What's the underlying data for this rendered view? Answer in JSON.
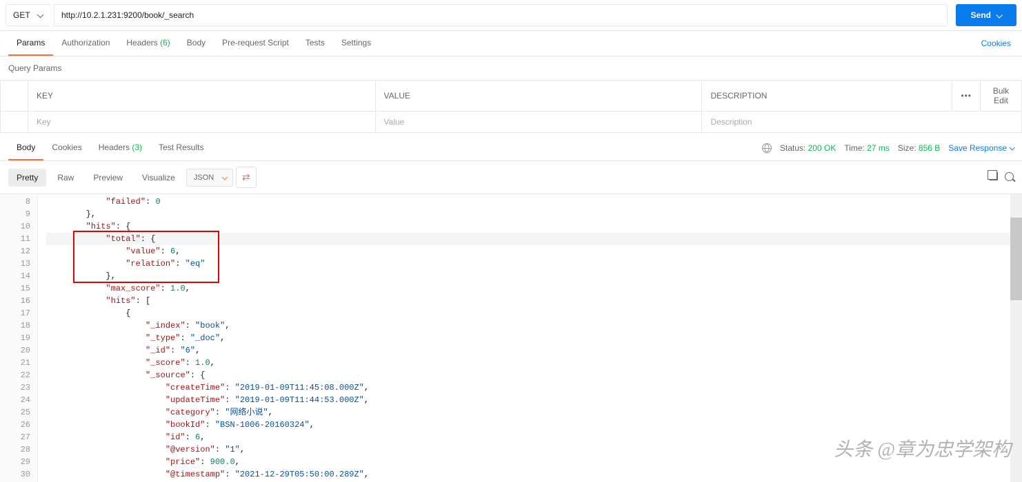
{
  "request": {
    "method": "GET",
    "url": "http://10.2.1.231:9200/book/_search"
  },
  "actions": {
    "send": "Send",
    "cookies": "Cookies"
  },
  "reqTabs": {
    "params": "Params",
    "auth": "Authorization",
    "headers": "Headers",
    "headers_count": "(6)",
    "body": "Body",
    "prereq": "Pre-request Script",
    "tests": "Tests",
    "settings": "Settings"
  },
  "paramsSection": {
    "title": "Query Params",
    "cols": {
      "key": "KEY",
      "value": "VALUE",
      "desc": "DESCRIPTION",
      "bulk": "Bulk Edit"
    },
    "placeholders": {
      "key": "Key",
      "value": "Value",
      "desc": "Description"
    }
  },
  "respTabs": {
    "body": "Body",
    "cookies": "Cookies",
    "headers": "Headers",
    "headers_count": "(3)",
    "tests": "Test Results"
  },
  "respMeta": {
    "status_label": "Status:",
    "status_value": "200 OK",
    "time_label": "Time:",
    "time_value": "27 ms",
    "size_label": "Size:",
    "size_value": "856 B",
    "save": "Save Response"
  },
  "viewBar": {
    "pretty": "Pretty",
    "raw": "Raw",
    "preview": "Preview",
    "visualize": "Visualize",
    "format": "JSON"
  },
  "codeLines": [
    {
      "n": 8,
      "indent": 3,
      "tokens": [
        [
          "key",
          "\"failed\""
        ],
        [
          "punc",
          ": "
        ],
        [
          "num",
          "0"
        ]
      ]
    },
    {
      "n": 9,
      "indent": 2,
      "tokens": [
        [
          "punc",
          "},"
        ]
      ]
    },
    {
      "n": 10,
      "indent": 2,
      "tokens": [
        [
          "key",
          "\"hits\""
        ],
        [
          "punc",
          ": {"
        ]
      ]
    },
    {
      "n": 11,
      "indent": 3,
      "hl": true,
      "tokens": [
        [
          "key",
          "\"total\""
        ],
        [
          "punc",
          ": {"
        ]
      ]
    },
    {
      "n": 12,
      "indent": 4,
      "tokens": [
        [
          "key",
          "\"value\""
        ],
        [
          "punc",
          ": "
        ],
        [
          "num",
          "6"
        ],
        [
          "punc",
          ","
        ]
      ]
    },
    {
      "n": 13,
      "indent": 4,
      "tokens": [
        [
          "key",
          "\"relation\""
        ],
        [
          "punc",
          ": "
        ],
        [
          "str",
          "\"eq\""
        ]
      ]
    },
    {
      "n": 14,
      "indent": 3,
      "tokens": [
        [
          "punc",
          "},"
        ]
      ]
    },
    {
      "n": 15,
      "indent": 3,
      "tokens": [
        [
          "key",
          "\"max_score\""
        ],
        [
          "punc",
          ": "
        ],
        [
          "num",
          "1.0"
        ],
        [
          "punc",
          ","
        ]
      ]
    },
    {
      "n": 16,
      "indent": 3,
      "tokens": [
        [
          "key",
          "\"hits\""
        ],
        [
          "punc",
          ": ["
        ]
      ]
    },
    {
      "n": 17,
      "indent": 4,
      "tokens": [
        [
          "punc",
          "{"
        ]
      ]
    },
    {
      "n": 18,
      "indent": 5,
      "tokens": [
        [
          "key",
          "\"_index\""
        ],
        [
          "punc",
          ": "
        ],
        [
          "str",
          "\"book\""
        ],
        [
          "punc",
          ","
        ]
      ]
    },
    {
      "n": 19,
      "indent": 5,
      "tokens": [
        [
          "key",
          "\"_type\""
        ],
        [
          "punc",
          ": "
        ],
        [
          "str",
          "\"_doc\""
        ],
        [
          "punc",
          ","
        ]
      ]
    },
    {
      "n": 20,
      "indent": 5,
      "tokens": [
        [
          "key",
          "\"_id\""
        ],
        [
          "punc",
          ": "
        ],
        [
          "str",
          "\"6\""
        ],
        [
          "punc",
          ","
        ]
      ]
    },
    {
      "n": 21,
      "indent": 5,
      "tokens": [
        [
          "key",
          "\"_score\""
        ],
        [
          "punc",
          ": "
        ],
        [
          "num",
          "1.0"
        ],
        [
          "punc",
          ","
        ]
      ]
    },
    {
      "n": 22,
      "indent": 5,
      "tokens": [
        [
          "key",
          "\"_source\""
        ],
        [
          "punc",
          ": {"
        ]
      ]
    },
    {
      "n": 23,
      "indent": 6,
      "tokens": [
        [
          "key",
          "\"createTime\""
        ],
        [
          "punc",
          ": "
        ],
        [
          "str",
          "\"2019-01-09T11:45:08.000Z\""
        ],
        [
          "punc",
          ","
        ]
      ]
    },
    {
      "n": 24,
      "indent": 6,
      "tokens": [
        [
          "key",
          "\"updateTime\""
        ],
        [
          "punc",
          ": "
        ],
        [
          "str",
          "\"2019-01-09T11:44:53.000Z\""
        ],
        [
          "punc",
          ","
        ]
      ]
    },
    {
      "n": 25,
      "indent": 6,
      "tokens": [
        [
          "key",
          "\"category\""
        ],
        [
          "punc",
          ": "
        ],
        [
          "str",
          "\"网络小说\""
        ],
        [
          "punc",
          ","
        ]
      ]
    },
    {
      "n": 26,
      "indent": 6,
      "tokens": [
        [
          "key",
          "\"bookId\""
        ],
        [
          "punc",
          ": "
        ],
        [
          "str",
          "\"BSN-1006-20160324\""
        ],
        [
          "punc",
          ","
        ]
      ]
    },
    {
      "n": 27,
      "indent": 6,
      "tokens": [
        [
          "key",
          "\"id\""
        ],
        [
          "punc",
          ": "
        ],
        [
          "num",
          "6"
        ],
        [
          "punc",
          ","
        ]
      ]
    },
    {
      "n": 28,
      "indent": 6,
      "tokens": [
        [
          "key",
          "\"@version\""
        ],
        [
          "punc",
          ": "
        ],
        [
          "str",
          "\"1\""
        ],
        [
          "punc",
          ","
        ]
      ]
    },
    {
      "n": 29,
      "indent": 6,
      "tokens": [
        [
          "key",
          "\"price\""
        ],
        [
          "punc",
          ": "
        ],
        [
          "num",
          "900.0"
        ],
        [
          "punc",
          ","
        ]
      ]
    },
    {
      "n": 30,
      "indent": 6,
      "tokens": [
        [
          "key",
          "\"@timestamp\""
        ],
        [
          "punc",
          ": "
        ],
        [
          "str",
          "\"2021-12-29T05:50:00.289Z\""
        ],
        [
          "punc",
          ","
        ]
      ]
    }
  ],
  "watermark": "头条 @章为忠学架构"
}
